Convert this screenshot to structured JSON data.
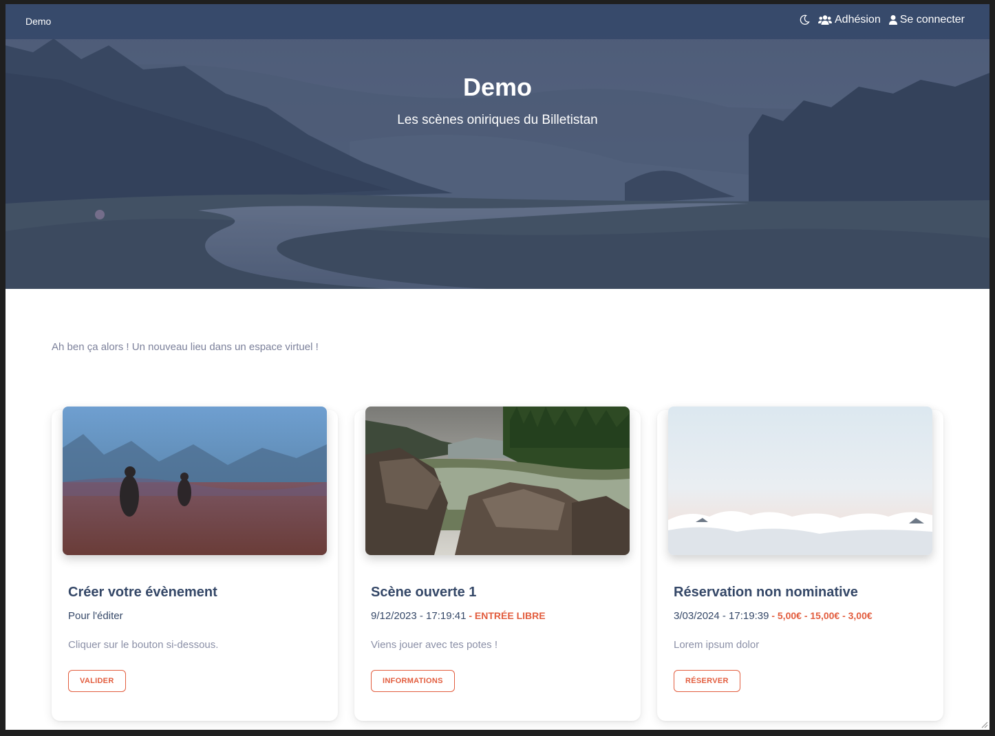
{
  "navbar": {
    "brand": "Demo",
    "items": [
      {
        "label": "",
        "icon": "moon-icon"
      },
      {
        "label": "Adhésion",
        "icon": "users-icon"
      },
      {
        "label": "Se connecter",
        "icon": "user-icon"
      }
    ]
  },
  "hero": {
    "title": "Demo",
    "subtitle": "Les scènes oniriques du Billetistan"
  },
  "intro": "Ah ben ça alors ! Un nouveau lieu dans un espace virtuel !",
  "cards": [
    {
      "title": "Créer votre évènement",
      "meta": "Pour l'éditer",
      "price": "",
      "description": "Cliquer sur le bouton si-dessous.",
      "button": "VALIDER"
    },
    {
      "title": "Scène ouverte 1",
      "meta": "9/12/2023 - 17:19:41",
      "price": " - ENTRÉE LIBRE",
      "description": "Viens jouer avec tes potes !",
      "button": "INFORMATIONS"
    },
    {
      "title": "Réservation non nominative",
      "meta": "3/03/2024 - 17:19:39",
      "price": " - 5,00€ - 15,00€ - 3,00€",
      "description": "Lorem ipsum dolor",
      "button": "RÉSERVER"
    }
  ],
  "colors": {
    "accent": "#e25c3d",
    "title": "#344767",
    "navbar": "#344668",
    "muted": "#7b809a"
  }
}
